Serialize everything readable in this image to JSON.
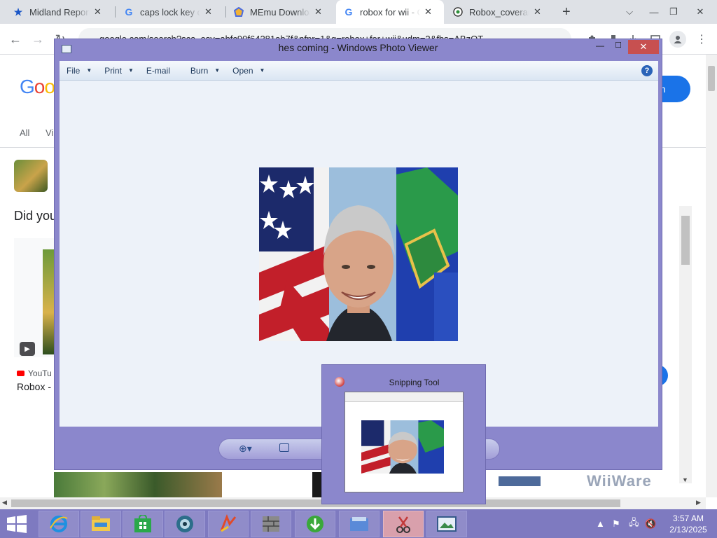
{
  "browser": {
    "tabs": [
      {
        "title": "Midland Reporte",
        "icon": "star-icon",
        "active": false
      },
      {
        "title": "caps lock key on",
        "icon": "google-g-icon",
        "active": false
      },
      {
        "title": "MEmu Downloa",
        "icon": "memu-icon",
        "active": false
      },
      {
        "title": "robox for wii - G",
        "icon": "google-g-icon",
        "active": true
      },
      {
        "title": "Robox_coverart.",
        "icon": "wikipedia-icon",
        "active": false
      }
    ],
    "close_glyph": "✕",
    "new_tab_glyph": "+",
    "address": "google.com/search?sca_esv=abfc90f64281ab7f&nfpr=1&q=robox+for+wii&udm=2&fbs=ABzOT",
    "window_controls": {
      "chevron": "⌵",
      "min": "—",
      "restore": "❐",
      "close": "✕"
    },
    "toolbar_glyphs": {
      "back": "←",
      "forward": "→",
      "reload": "↻"
    }
  },
  "google_page": {
    "logo": [
      "G",
      "o",
      "o"
    ],
    "filter_all": "All",
    "filter_vi": "Vi",
    "did_you": "Did you",
    "youtube_label": "YouTu",
    "result_title": "Robox -",
    "sign_in": "n in",
    "wiiware_text": "WiiWare",
    "play_glyph": "▶"
  },
  "photo_viewer": {
    "title": "hes coming - Windows Photo Viewer",
    "menus": [
      {
        "label": "File",
        "dropdown": true
      },
      {
        "label": "Print",
        "dropdown": true
      },
      {
        "label": "E-mail",
        "dropdown": false
      },
      {
        "label": "Burn",
        "dropdown": true
      },
      {
        "label": "Open",
        "dropdown": true
      }
    ],
    "help_glyph": "?",
    "dropdown_glyph": "▼",
    "min_glyph": "—",
    "max_glyph": "☐",
    "close_glyph": "✕",
    "zoom_glyph": "⊕▾"
  },
  "snipping_tool": {
    "title": "Snipping Tool"
  },
  "taskbar": {
    "apps": [
      {
        "name": "internet-explorer-icon",
        "active": false
      },
      {
        "name": "file-explorer-icon",
        "active": false
      },
      {
        "name": "store-icon",
        "active": false
      },
      {
        "name": "globe-app-icon",
        "active": false
      },
      {
        "name": "paint-app-icon",
        "active": false
      },
      {
        "name": "bricks-app-icon",
        "active": false
      },
      {
        "name": "download-manager-icon",
        "active": false
      },
      {
        "name": "folder-app-icon",
        "active": false
      },
      {
        "name": "snipping-tool-icon",
        "active": true
      },
      {
        "name": "photo-viewer-icon",
        "active": false
      }
    ],
    "time": "3:57 AM",
    "date": "2/13/2025",
    "tray_up": "▲",
    "tray_flag": "⚑",
    "tray_network": "🖧",
    "tray_volume": "🔇"
  },
  "colors": {
    "window_frame": "#8b87cc",
    "taskbar": "#7e7ac0",
    "close_button": "#c75050",
    "google_blue": "#1a73e8"
  }
}
